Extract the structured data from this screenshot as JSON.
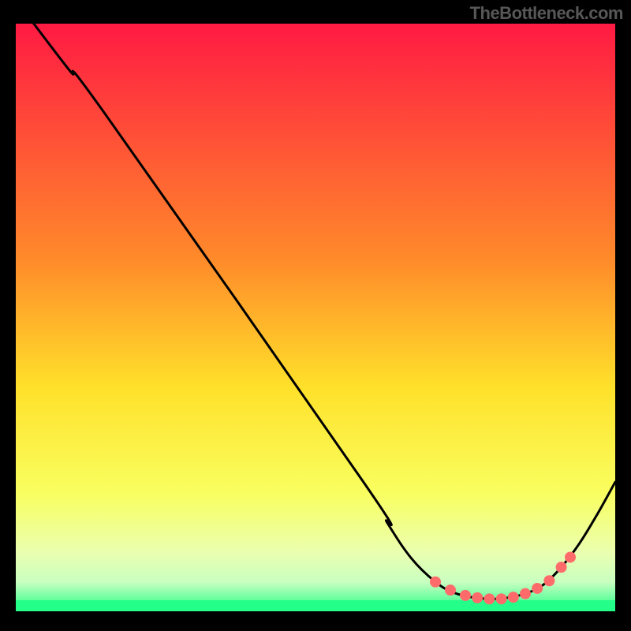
{
  "watermark": "TheBottleneck.com",
  "chart_data": {
    "type": "line",
    "title": "",
    "xlabel": "",
    "ylabel": "",
    "xlim": [
      0,
      100
    ],
    "ylim": [
      0,
      100
    ],
    "background_gradient": {
      "stops": [
        {
          "offset": 0,
          "color": "#ff1a43"
        },
        {
          "offset": 40,
          "color": "#ff8a2a"
        },
        {
          "offset": 62,
          "color": "#ffe12a"
        },
        {
          "offset": 80,
          "color": "#f9ff60"
        },
        {
          "offset": 90,
          "color": "#eaffb0"
        },
        {
          "offset": 95,
          "color": "#c9ffc0"
        },
        {
          "offset": 100,
          "color": "#23ff88"
        }
      ],
      "bottom_band_color": "#23ff88"
    },
    "series": [
      {
        "name": "curve",
        "points": [
          {
            "x": 3,
            "y": 100
          },
          {
            "x": 9,
            "y": 92
          },
          {
            "x": 15,
            "y": 84.5
          },
          {
            "x": 58,
            "y": 22
          },
          {
            "x": 62,
            "y": 15
          },
          {
            "x": 66,
            "y": 9
          },
          {
            "x": 70,
            "y": 5
          },
          {
            "x": 73,
            "y": 3.2
          },
          {
            "x": 76,
            "y": 2.4
          },
          {
            "x": 79,
            "y": 2.1
          },
          {
            "x": 82,
            "y": 2.3
          },
          {
            "x": 85,
            "y": 3.0
          },
          {
            "x": 88,
            "y": 4.5
          },
          {
            "x": 91,
            "y": 7.5
          },
          {
            "x": 94,
            "y": 11.5
          },
          {
            "x": 97,
            "y": 16.5
          },
          {
            "x": 100,
            "y": 22
          }
        ]
      }
    ],
    "markers": [
      {
        "x": 70,
        "y": 5.0
      },
      {
        "x": 72.5,
        "y": 3.6
      },
      {
        "x": 75,
        "y": 2.7
      },
      {
        "x": 77,
        "y": 2.3
      },
      {
        "x": 79,
        "y": 2.1
      },
      {
        "x": 81,
        "y": 2.1
      },
      {
        "x": 83,
        "y": 2.4
      },
      {
        "x": 85,
        "y": 3.0
      },
      {
        "x": 87,
        "y": 3.9
      },
      {
        "x": 89,
        "y": 5.2
      },
      {
        "x": 91,
        "y": 7.5
      },
      {
        "x": 92.5,
        "y": 9.2
      }
    ],
    "marker_color": "#ff6b6b",
    "curve_color": "#000000"
  }
}
